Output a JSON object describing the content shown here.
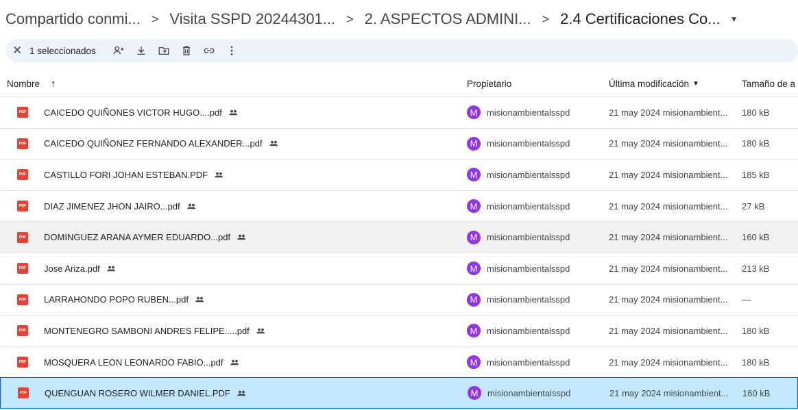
{
  "breadcrumb": {
    "items": [
      "Compartido conmi...",
      "Visita SSPD 20244301...",
      "2. ASPECTOS ADMINI...",
      "2.4 Certificaciones Co..."
    ],
    "separator": ">",
    "dropdown_icon": "caret-down-icon"
  },
  "selection_bar": {
    "close_icon": "close-icon",
    "count_label": "1 seleccionados",
    "actions": [
      "share-icon",
      "download-icon",
      "move-icon",
      "delete-icon",
      "link-icon",
      "more-vert-icon"
    ]
  },
  "table": {
    "headers": {
      "name": "Nombre",
      "owner": "Propietario",
      "modified": "Última modificación",
      "size": "Tamaño de a"
    },
    "rows": [
      {
        "name": "CAICEDO QUIÑONES VICTOR HUGO....pdf",
        "owner_initial": "M",
        "owner": "misionambientalsspd",
        "modified": "21 may 2024 misionambient...",
        "size": "180 kB"
      },
      {
        "name": "CAICEDO QUIÑONEZ  FERNANDO ALEXANDER...pdf",
        "owner_initial": "M",
        "owner": "misionambientalsspd",
        "modified": "21 may 2024 misionambient...",
        "size": "180 kB"
      },
      {
        "name": "CASTILLO FORI JOHAN ESTEBAN.PDF",
        "owner_initial": "M",
        "owner": "misionambientalsspd",
        "modified": "21 may 2024 misionambient...",
        "size": "185 kB"
      },
      {
        "name": "DIAZ JIMENEZ JHON JAIRO...pdf",
        "owner_initial": "M",
        "owner": "misionambientalsspd",
        "modified": "21 may 2024 misionambient...",
        "size": "27 kB"
      },
      {
        "name": "DOMINGUEZ ARANA AYMER EDUARDO...pdf",
        "owner_initial": "M",
        "owner": "misionambientalsspd",
        "modified": "21 may 2024 misionambient...",
        "size": "160 kB"
      },
      {
        "name": "Jose Ariza.pdf",
        "owner_initial": "M",
        "owner": "misionambientalsspd",
        "modified": "21 may 2024 misionambient...",
        "size": "213 kB"
      },
      {
        "name": "LARRAHONDO POPO RUBEN...pdf",
        "owner_initial": "M",
        "owner": "misionambientalsspd",
        "modified": "21 may 2024 misionambient...",
        "size": "—"
      },
      {
        "name": "MONTENEGRO SAMBONI ANDRES FELIPE.....pdf",
        "owner_initial": "M",
        "owner": "misionambientalsspd",
        "modified": "21 may 2024 misionambient...",
        "size": "180 kB"
      },
      {
        "name": "MOSQUERA LEON LEONARDO FABIO...pdf",
        "owner_initial": "M",
        "owner": "misionambientalsspd",
        "modified": "21 may 2024 misionambient...",
        "size": "180 kB"
      },
      {
        "name": "QUENGUAN ROSERO WILMER DANIEL.PDF",
        "owner_initial": "M",
        "owner": "misionambientalsspd",
        "modified": "21 may 2024 misionambient...",
        "size": "160 kB"
      }
    ],
    "file_icon_text": "PDF"
  },
  "colors": {
    "selected_row": "#c2e7ff",
    "selected_border": "#0b57d0",
    "avatar": "#9334e6",
    "pdf_icon": "#ea4335",
    "toolbar_bg": "#eef2f9"
  }
}
